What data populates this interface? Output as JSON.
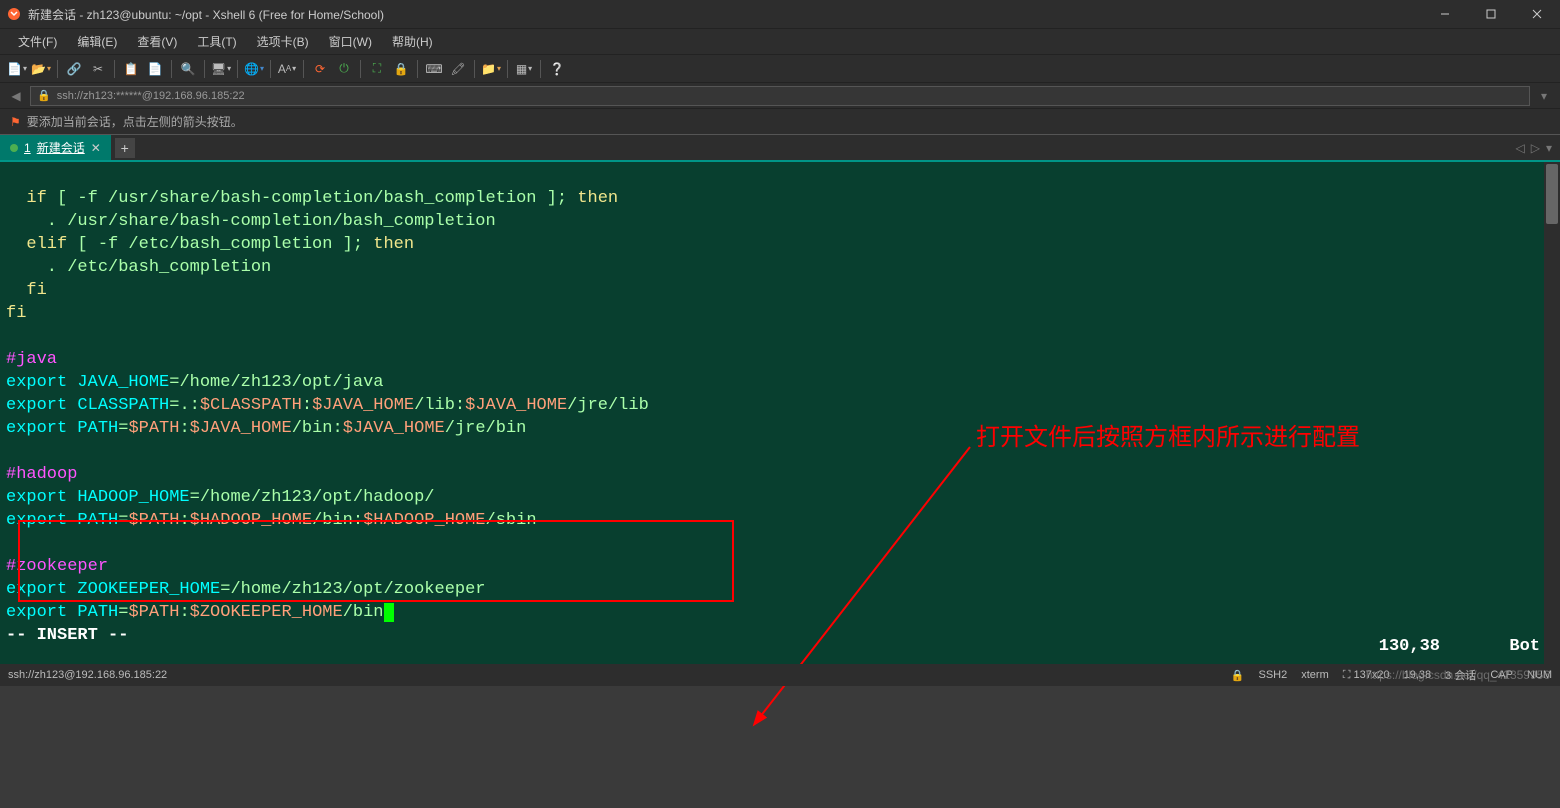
{
  "window": {
    "title": "新建会话 - zh123@ubuntu: ~/opt - Xshell 6 (Free for Home/School)"
  },
  "menu": {
    "file": "文件(F)",
    "edit": "编辑(E)",
    "view": "查看(V)",
    "tools": "工具(T)",
    "tabs": "选项卡(B)",
    "window": "窗口(W)",
    "help": "帮助(H)"
  },
  "address": {
    "url": "ssh://zh123:******@192.168.96.185:22"
  },
  "hint": {
    "text": "要添加当前会话，点击左侧的箭头按钮。"
  },
  "tabs": {
    "main": {
      "number": "1",
      "label": "新建会话"
    }
  },
  "terminal": {
    "line1_if": "if",
    "line1_test": " [ -f /usr/share/bash-completion/bash_completion ]; ",
    "line1_then": "then",
    "line2": "    . /usr/share/bash-completion/bash_completion",
    "line3_elif": "elif",
    "line3_test": " [ -f /etc/bash_completion ]; ",
    "line3_then": "then",
    "line4": "    . /etc/bash_completion",
    "line5_fi": "  fi",
    "line6_fi": "fi",
    "java_cmt": "#java",
    "java_l1_exp": "export",
    "java_l1_var": " JAVA_HOME",
    "java_l1_eq": "=",
    "java_l1_val": "/home/zh123/opt/java",
    "java_l2_exp": "export",
    "java_l2_var": " CLASSPATH",
    "java_l2_eq": "=",
    "java_l2_a": ".:",
    "java_l2_b": "$CLASSPATH",
    "java_l2_c": ":",
    "java_l2_d": "$JAVA_HOME",
    "java_l2_e": "/lib:",
    "java_l2_f": "$JAVA_HOME",
    "java_l2_g": "/jre/lib",
    "java_l3_exp": "export",
    "java_l3_var": " PATH",
    "java_l3_eq": "=",
    "java_l3_a": "$PATH",
    "java_l3_b": ":",
    "java_l3_c": "$JAVA_HOME",
    "java_l3_d": "/bin:",
    "java_l3_e": "$JAVA_HOME",
    "java_l3_f": "/jre/bin",
    "hadoop_cmt": "#hadoop",
    "hadoop_l1_exp": "export",
    "hadoop_l1_var": " HADOOP_HOME",
    "hadoop_l1_eq": "=",
    "hadoop_l1_val": "/home/zh123/opt/hadoop/",
    "hadoop_l2_exp": "export",
    "hadoop_l2_var": " PATH",
    "hadoop_l2_eq": "=",
    "hadoop_l2_a": "$PATH",
    "hadoop_l2_b": ":",
    "hadoop_l2_c": "$HADOOP_HOME",
    "hadoop_l2_d": "/bin:",
    "hadoop_l2_e": "$HADOOP_HOME",
    "hadoop_l2_f": "/sbin",
    "zk_cmt": "#zookeeper",
    "zk_l1_exp": "export",
    "zk_l1_var": " ZOOKEEPER_HOME",
    "zk_l1_eq": "=",
    "zk_l1_val": "/home/zh123/opt/zookeeper",
    "zk_l2_exp": "export",
    "zk_l2_var": " PATH",
    "zk_l2_eq": "=",
    "zk_l2_a": "$PATH",
    "zk_l2_b": ":",
    "zk_l2_c": "$ZOOKEEPER_HOME",
    "zk_l2_d": "/bin",
    "mode": "-- INSERT --",
    "pos": "130,38",
    "loc": "Bot"
  },
  "annotation": "打开文件后按照方框内所示进行配置",
  "status": {
    "left": "ssh://zh123@192.168.96.185:22",
    "ssh": "SSH2",
    "term": "xterm",
    "size": "137x20",
    "pos": "19,38",
    "sess": "3 会话",
    "cap": "CAP",
    "num": "NUM"
  },
  "watermark": "https://blog.csdn.net/qq_42359956"
}
